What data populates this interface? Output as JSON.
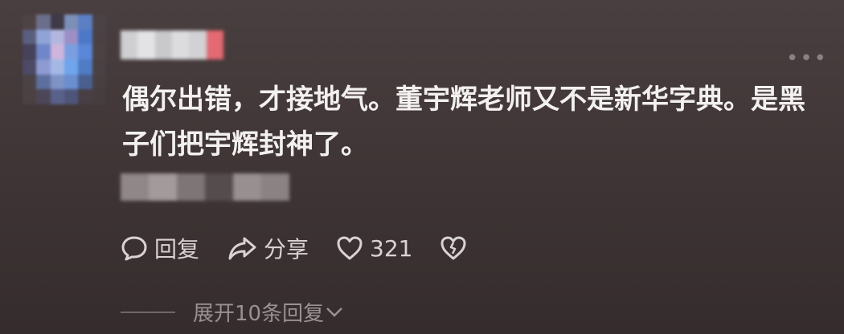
{
  "comment": {
    "text": "偶尔出错，才接地气。董宇辉老师又不是新华字典。是黑子们把宇辉封神了。"
  },
  "actions": {
    "reply_label": "回复",
    "share_label": "分享",
    "like_count": "321"
  },
  "replies": {
    "expand_label": "展开10条回复"
  },
  "icons": {
    "more": "more-dots-icon",
    "reply": "speech-bubble-icon",
    "share": "share-arrow-icon",
    "like": "heart-icon",
    "dislike": "broken-heart-icon",
    "expand": "chevron-down-icon"
  },
  "colors": {
    "background": "#3e3435",
    "text": "#f3f0f0",
    "muted": "#9a9192"
  }
}
